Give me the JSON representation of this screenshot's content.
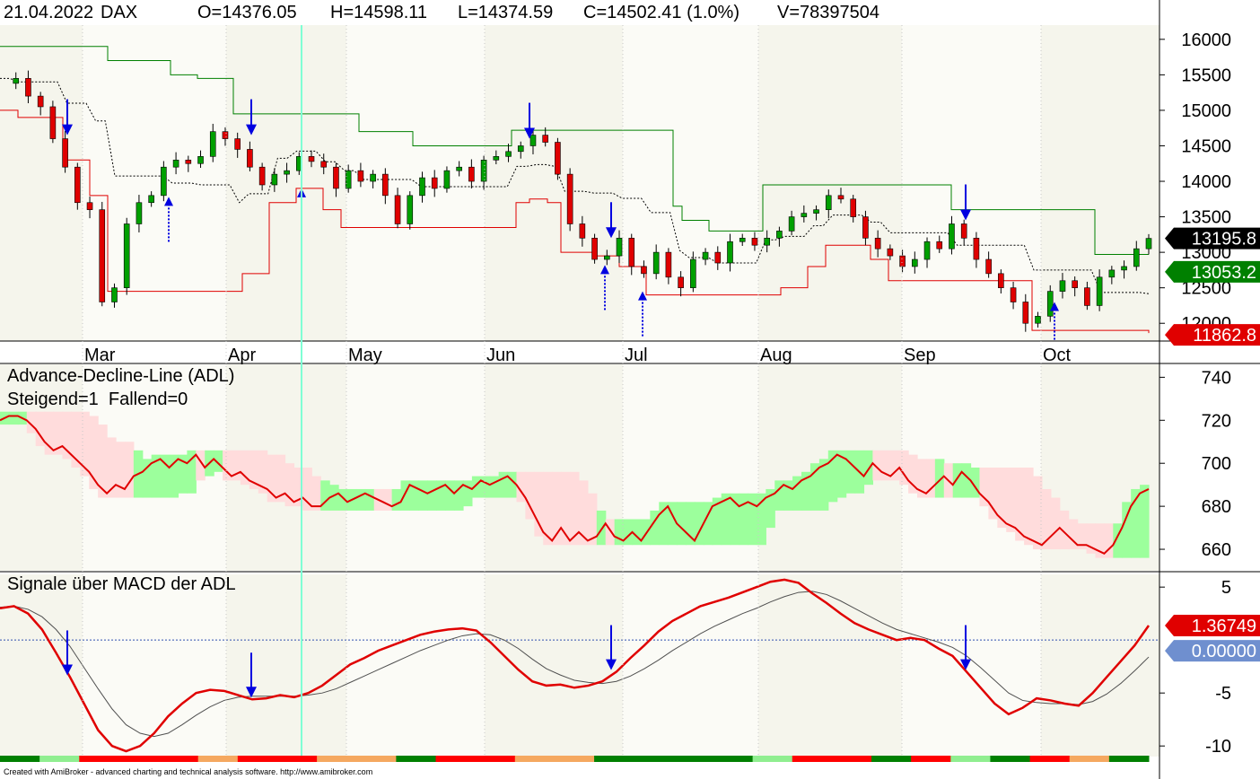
{
  "header": {
    "date": "21.04.2022",
    "symbol": "DAX",
    "open": "O=14376.05",
    "high": "H=14598.11",
    "low": "L=14374.59",
    "close": "C=14502.41 (1.0%)",
    "volume": "V=78397504"
  },
  "footer": "Created with AmiBroker - advanced charting and technical analysis software. http://www.amibroker.com",
  "colors": {
    "up_candle": "#00a000",
    "down_candle": "#e00000",
    "upper_band": "#008000",
    "lower_band": "#e00000",
    "mid_band": "#000000",
    "signal_arrow": "#0000e0",
    "adl_line": "#e00000",
    "bullish_cloud": "#9cff9c",
    "bearish_cloud": "#ffdcdc",
    "macd_line": "#e00000",
    "signal_line": "#505050",
    "cursor": "#7fffd4"
  },
  "panels": [
    {
      "id": "price",
      "title": "",
      "subtitle": ""
    },
    {
      "id": "adl",
      "title": "Advance-Decline-Line (ADL)",
      "subtitle": "Steigend=1  Fallend=0"
    },
    {
      "id": "macd",
      "title": "Signale über MACD der ADL",
      "subtitle": ""
    }
  ],
  "chart_data": [
    {
      "type": "candlestick",
      "title": "DAX",
      "months": [
        "Mar",
        "Apr",
        "May",
        "Jun",
        "Jul",
        "Aug",
        "Sep",
        "Oct"
      ],
      "y_ticks": [
        16000,
        15500,
        15000,
        14500,
        14000,
        13500,
        13000,
        12500,
        12000
      ],
      "ylim": [
        11750,
        16200
      ],
      "last_labels": [
        {
          "value": "13195.8",
          "color": "#000000"
        },
        {
          "value": "13053.2",
          "color": "#008000"
        },
        {
          "value": "11862.8",
          "color": "#e00000"
        }
      ],
      "close_path": [
        15380,
        15450,
        15200,
        15050,
        14600,
        14200,
        13700,
        13600,
        12300,
        12500,
        13400,
        13700,
        13800,
        14200,
        14300,
        14250,
        14350,
        14700,
        14600,
        14450,
        14200,
        13950,
        14100,
        14150,
        14350,
        14280,
        14200,
        13900,
        14150,
        14000,
        14100,
        13800,
        13400,
        13800,
        14050,
        13900,
        14150,
        14200,
        14000,
        14300,
        14350,
        14420,
        14500,
        14650,
        14550,
        14100,
        13400,
        13200,
        12900,
        12950,
        13200,
        12800,
        12700,
        13000,
        12650,
        12500,
        12900,
        13000,
        12850,
        13150,
        13200,
        13100,
        13200,
        13300,
        13500,
        13550,
        13600,
        13800,
        13750,
        13500,
        13200,
        13050,
        12950,
        12800,
        12900,
        13150,
        13050,
        13400,
        13200,
        12900,
        12700,
        12500,
        12300,
        12000,
        12100,
        12450,
        12600,
        12500,
        12250,
        12650,
        12750,
        12800,
        13050,
        13195.8
      ],
      "upper_band": [
        15900,
        15900,
        15900,
        15700,
        15700,
        15700,
        15500,
        15500,
        15500,
        15450,
        15450,
        15450,
        14950,
        14950,
        14950,
        14950,
        14950,
        14950,
        14700,
        14500,
        14500,
        14500,
        14500,
        14500,
        14720,
        14720,
        14720,
        14720,
        14720,
        14720,
        14720,
        14720,
        13650,
        13450,
        13300,
        13300,
        13950,
        13950,
        13950,
        13950,
        13950,
        13950,
        13600,
        13600,
        13600,
        13600,
        13600,
        13600,
        12970,
        12970,
        12970
      ],
      "upper_band_x": [
        0,
        40,
        80,
        120,
        140,
        180,
        190,
        200,
        210,
        220,
        235,
        250,
        260,
        300,
        340,
        360,
        370,
        380,
        400,
        460,
        480,
        520,
        540,
        555,
        570,
        600,
        640,
        680,
        700,
        720,
        730,
        740,
        750,
        760,
        790,
        830,
        850,
        880,
        900,
        960,
        1000,
        1030,
        1060,
        1080,
        1100,
        1160,
        1200,
        1210,
        1220,
        1260,
        1280
      ],
      "lower_band": [
        15000,
        14900,
        14900,
        14300,
        13800,
        12450,
        12450,
        12450,
        12450,
        12700,
        13700,
        13900,
        13900,
        13600,
        13350,
        13350,
        13350,
        13700,
        13750,
        13700,
        13000,
        12950,
        12800,
        12800,
        12400,
        12400,
        12400,
        12500,
        12800,
        13100,
        13100,
        12900,
        12600,
        12600,
        12600,
        12600,
        12600,
        11900,
        11900,
        11862.8
      ],
      "lower_band_x": [
        0,
        20,
        40,
        70,
        100,
        120,
        160,
        200,
        255,
        270,
        300,
        330,
        340,
        360,
        380,
        420,
        560,
        575,
        590,
        610,
        625,
        660,
        690,
        700,
        720,
        800,
        850,
        870,
        900,
        920,
        940,
        970,
        990,
        1010,
        1050,
        1100,
        1130,
        1150,
        1200,
        1280
      ],
      "signals": [
        {
          "kind": "sell",
          "x": 75,
          "price": 14650
        },
        {
          "kind": "buy",
          "x": 188,
          "price": 13780
        },
        {
          "kind": "sell",
          "x": 280,
          "price": 14650
        },
        {
          "kind": "buy",
          "x": 336,
          "price": 13900
        },
        {
          "kind": "sell",
          "x": 590,
          "price": 14600
        },
        {
          "kind": "sell",
          "x": 681,
          "price": 13200
        },
        {
          "kind": "buy",
          "x": 674,
          "price": 12820
        },
        {
          "kind": "buy",
          "x": 716,
          "price": 12450
        },
        {
          "kind": "sell",
          "x": 1076,
          "price": 13450
        },
        {
          "kind": "buy",
          "x": 1175,
          "price": 12300
        }
      ]
    },
    {
      "type": "line",
      "title": "Advance-Decline-Line (ADL)",
      "subtitle": "Steigend=1  Fallend=0",
      "y_ticks": [
        740,
        720,
        700,
        680,
        660
      ],
      "ylim": [
        650,
        746
      ],
      "values": [
        720,
        722,
        722,
        720,
        716,
        710,
        706,
        708,
        704,
        700,
        696,
        690,
        686,
        690,
        688,
        694,
        696,
        700,
        702,
        698,
        702,
        700,
        704,
        698,
        702,
        698,
        694,
        696,
        692,
        690,
        688,
        684,
        686,
        682,
        684,
        680,
        680,
        684,
        686,
        682,
        684,
        686,
        684,
        682,
        680,
        682,
        690,
        688,
        686,
        688,
        690,
        686,
        690,
        688,
        692,
        690,
        692,
        694,
        690,
        684,
        676,
        668,
        664,
        670,
        664,
        668,
        664,
        666,
        672,
        666,
        664,
        668,
        664,
        670,
        676,
        680,
        672,
        668,
        664,
        672,
        680,
        682,
        684,
        680,
        682,
        680,
        684,
        686,
        690,
        688,
        692,
        694,
        698,
        700,
        704,
        702,
        698,
        694,
        700,
        696,
        694,
        698,
        692,
        688,
        686,
        690,
        694,
        690,
        696,
        692,
        686,
        682,
        676,
        672,
        670,
        666,
        664,
        662,
        666,
        670,
        666,
        662,
        662,
        660,
        658,
        662,
        670,
        680,
        686,
        688
      ]
    },
    {
      "type": "line",
      "title": "Signale über MACD der ADL",
      "y_ticks": [
        5,
        -5,
        -10
      ],
      "ylim": [
        -11,
        6.2
      ],
      "last_labels": [
        {
          "value": "1.36749",
          "color": "#e00000"
        },
        {
          "value": "0.00000",
          "color": "#6f8fcf"
        }
      ],
      "series": [
        {
          "values": [
            3.0,
            3.2,
            2.5,
            1.0,
            -1.2,
            -3.5,
            -6.0,
            -8.5,
            -10.0,
            -10.5,
            -10.0,
            -8.8,
            -7.2,
            -6.0,
            -5.0,
            -4.7,
            -4.8,
            -5.2,
            -5.6,
            -5.5,
            -5.2,
            -5.4,
            -5.0,
            -4.3,
            -3.3,
            -2.3,
            -1.7,
            -1.0,
            -0.5,
            0.0,
            0.5,
            0.8,
            1.0,
            1.1,
            0.9,
            -0.2,
            -1.5,
            -2.8,
            -3.9,
            -4.3,
            -4.2,
            -4.5,
            -4.3,
            -3.9,
            -3.0,
            -1.7,
            -0.5,
            0.8,
            1.8,
            2.5,
            3.2,
            3.6,
            4.0,
            4.5,
            5.0,
            5.5,
            5.7,
            5.4,
            4.4,
            3.5,
            2.5,
            1.6,
            1.0,
            0.5,
            0.0,
            0.2,
            0.0,
            -0.8,
            -1.5,
            -3.0,
            -4.5,
            -6.0,
            -7.0,
            -6.4,
            -5.5,
            -5.7,
            -6.0,
            -6.2,
            -5.0,
            -3.5,
            -2.0,
            -0.5,
            1.36749
          ]
        },
        {
          "values": [
            3.1,
            3.2,
            2.9,
            2.2,
            1.0,
            -0.6,
            -2.6,
            -4.6,
            -6.5,
            -8.0,
            -8.8,
            -9.1,
            -8.8,
            -8.0,
            -7.1,
            -6.3,
            -5.7,
            -5.4,
            -5.3,
            -5.3,
            -5.3,
            -5.3,
            -5.2,
            -5.0,
            -4.6,
            -4.0,
            -3.4,
            -2.8,
            -2.2,
            -1.6,
            -1.0,
            -0.5,
            0.0,
            0.4,
            0.6,
            0.5,
            0.0,
            -0.8,
            -1.8,
            -2.7,
            -3.3,
            -3.8,
            -4.0,
            -4.1,
            -3.9,
            -3.4,
            -2.7,
            -1.9,
            -1.0,
            -0.2,
            0.6,
            1.3,
            1.9,
            2.5,
            3.0,
            3.6,
            4.1,
            4.5,
            4.6,
            4.3,
            3.7,
            3.0,
            2.3,
            1.6,
            1.0,
            0.6,
            0.2,
            -0.2,
            -0.7,
            -1.5,
            -2.6,
            -3.8,
            -5.0,
            -5.7,
            -5.9,
            -6.0,
            -6.0,
            -6.1,
            -5.8,
            -5.1,
            -4.1,
            -2.9,
            -1.6
          ]
        }
      ],
      "signals_x": [
        75,
        280,
        681,
        1076
      ],
      "status_bar": [
        "g",
        "lg",
        "r",
        "r",
        "r",
        "o",
        "r",
        "r",
        "o",
        "o",
        "g",
        "r",
        "r",
        "o",
        "o",
        "g",
        "g",
        "g",
        "g",
        "lg",
        "r",
        "r",
        "g",
        "r",
        "lg",
        "g",
        "r",
        "o",
        "g"
      ]
    }
  ]
}
